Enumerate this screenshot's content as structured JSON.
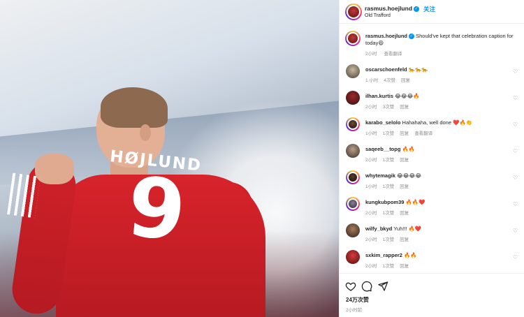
{
  "photo": {
    "jersey_name": "HØJLUND",
    "jersey_number": "9"
  },
  "header": {
    "username": "rasmus.hoejlund",
    "follow_label": "关注",
    "location": "Old Trafford",
    "verified_icon": "verified-badge-icon"
  },
  "caption": {
    "username": "rasmus.hoejlund",
    "text": "Should've kept that celebration caption for today😄",
    "time": "2小时",
    "translate": "查看翻译"
  },
  "comments": [
    {
      "username": "oscarschoenfeld",
      "text": "🐆🐆🐆",
      "time": "1 小时",
      "likes": "4次赞",
      "reply": "回复"
    },
    {
      "username": "ilhan.kurtis",
      "text": "😂😂😂🔥",
      "time": "2小时",
      "likes": "3次赞",
      "reply": "回复"
    },
    {
      "username": "karabo_selolo",
      "text": "Hahahaha, well done ❤️🔥👏",
      "time": "1小时",
      "likes": "1次赞",
      "reply": "回复",
      "translate": "查看翻译"
    },
    {
      "username": "saqeeb__topg",
      "text": "🔥🔥",
      "time": "2小时",
      "likes": "1次赞",
      "reply": "回复"
    },
    {
      "username": "whytemagik",
      "text": "😂😂😂😂",
      "time": "1小时",
      "likes": "1次赞",
      "reply": "回复"
    },
    {
      "username": "kungkubpom39",
      "text": "🔥🔥❤️",
      "time": "2小时",
      "likes": "1次赞",
      "reply": "回复"
    },
    {
      "username": "wilfy_bkyd",
      "text": "Yuh!!! 🔥❤️",
      "time": "2小时",
      "likes": "1次赞",
      "reply": "回复"
    },
    {
      "username": "sxkim_rapper2",
      "text": "🔥🔥",
      "time": "2小时",
      "likes": "1次赞",
      "reply": "回复"
    }
  ],
  "actions": {
    "like_icon": "heart-icon",
    "comment_icon": "comment-icon",
    "share_icon": "share-icon"
  },
  "footer": {
    "likes": "24万次赞",
    "time": "2小时前"
  },
  "colors": {
    "brand_blue": "#0095f6",
    "jersey_red": "#d8232a"
  }
}
